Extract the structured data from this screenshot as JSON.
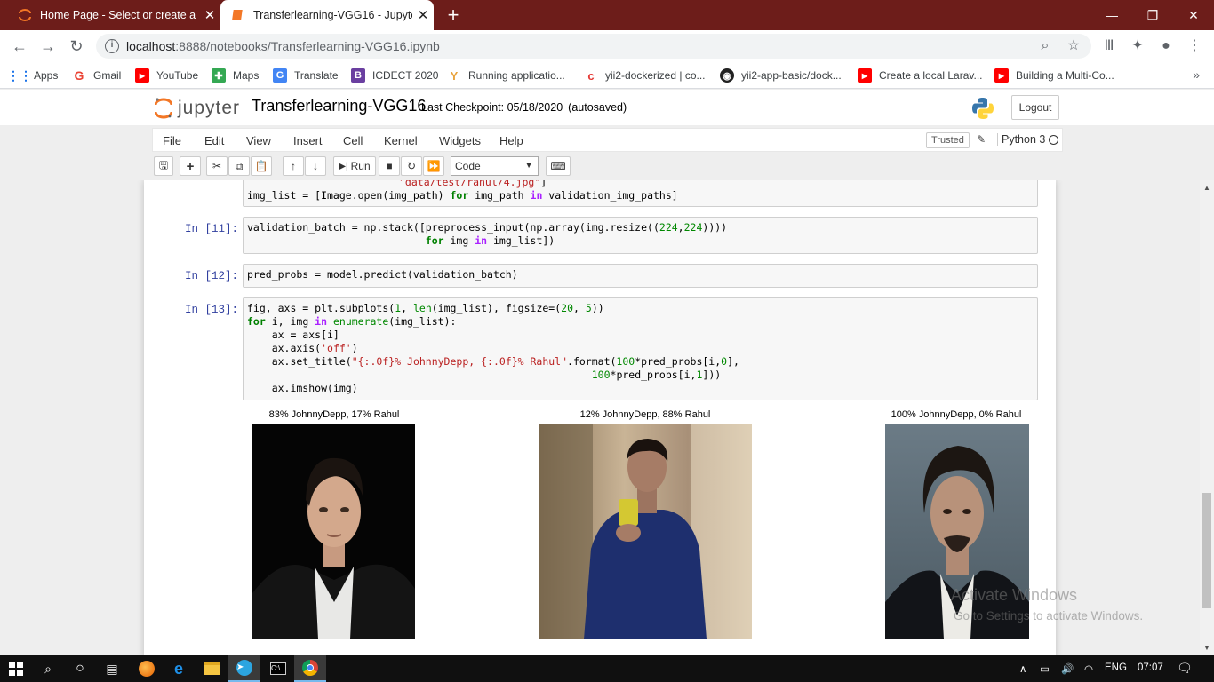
{
  "browser": {
    "tabs": [
      {
        "title": "Home Page - Select or create a n",
        "active": false
      },
      {
        "title": "Transferlearning-VGG16 - Jupyte",
        "active": true
      }
    ],
    "url_host": "localhost",
    "url_rest": ":8888/notebooks/Transferlearning-VGG16.ipynb",
    "bookmarks": [
      "Apps",
      "Gmail",
      "YouTube",
      "Maps",
      "Translate",
      "ICDECT 2020",
      "Running applicatio...",
      "yii2-dockerized | co...",
      "yii2-app-basic/dock...",
      "Create a local Larav...",
      "Building a Multi-Co..."
    ]
  },
  "jupyter": {
    "logo_text": "jupyter",
    "notebook_name": "Transferlearning-VGG16",
    "checkpoint": "Last Checkpoint: 05/18/2020",
    "autosaved": "(autosaved)",
    "logout": "Logout",
    "menus": [
      "File",
      "Edit",
      "View",
      "Insert",
      "Cell",
      "Kernel",
      "Widgets",
      "Help"
    ],
    "trusted": "Trusted",
    "kernel": "Python 3",
    "run_label": "Run",
    "cell_type": "Code"
  },
  "cells": [
    {
      "prompt": "In [11]:"
    },
    {
      "prompt": "In [12]:"
    },
    {
      "prompt": "In [13]:"
    }
  ],
  "outputs": [
    {
      "title": "83% JohnnyDepp, 17% Rahul"
    },
    {
      "title": "12% JohnnyDepp, 88% Rahul"
    },
    {
      "title": "100% JohnnyDepp, 0% Rahul"
    }
  ],
  "watermark": {
    "line1": "Activate Windows",
    "line2": "Go to Settings to activate Windows."
  },
  "taskbar": {
    "lang": "ENG",
    "time": "07:07"
  },
  "colors": {
    "chrome_frame": "#6d1d1a",
    "prompt": "#303f9f",
    "keyword": "#008000",
    "string": "#ba2121"
  }
}
